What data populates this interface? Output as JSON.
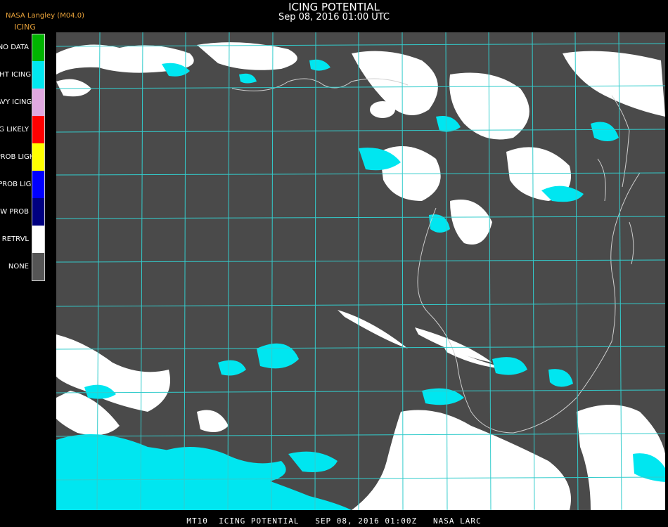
{
  "header": {
    "title": "ICING POTENTIAL",
    "datetime": "Sep 08, 2016 01:00 UTC",
    "source": "NASA Langley (M04.0)",
    "product": "ICING"
  },
  "legend": [
    {
      "label": "NO DATA",
      "color": "#00b400"
    },
    {
      "label": "NIGHT ICING",
      "color": "#00e8f0"
    },
    {
      "label": "HEAVY ICING",
      "color": "#e0a8e0"
    },
    {
      "label": "MOG LIKELY",
      "color": "#ff0000"
    },
    {
      "label": "HI PROB LIGHT",
      "color": "#ffff00"
    },
    {
      "label": "LO PROB LIGHT",
      "color": "#0000ff"
    },
    {
      "label": "LOW PROB",
      "color": "#000080"
    },
    {
      "label": "NO RETRVL",
      "color": "#ffffff"
    },
    {
      "label": "NONE",
      "color": "#555555"
    }
  ],
  "colors": {
    "background": "#000000",
    "map_background": "#4a4a4a",
    "grid": "#33cccc",
    "grid_labels": "#c03030",
    "coastline": "#cfcfcf",
    "no_retrieval": "#ffffff",
    "night_icing": "#00e6f0"
  },
  "footer": "MT10  ICING POTENTIAL   SEP 08, 2016 01:00Z   NASA LARC"
}
